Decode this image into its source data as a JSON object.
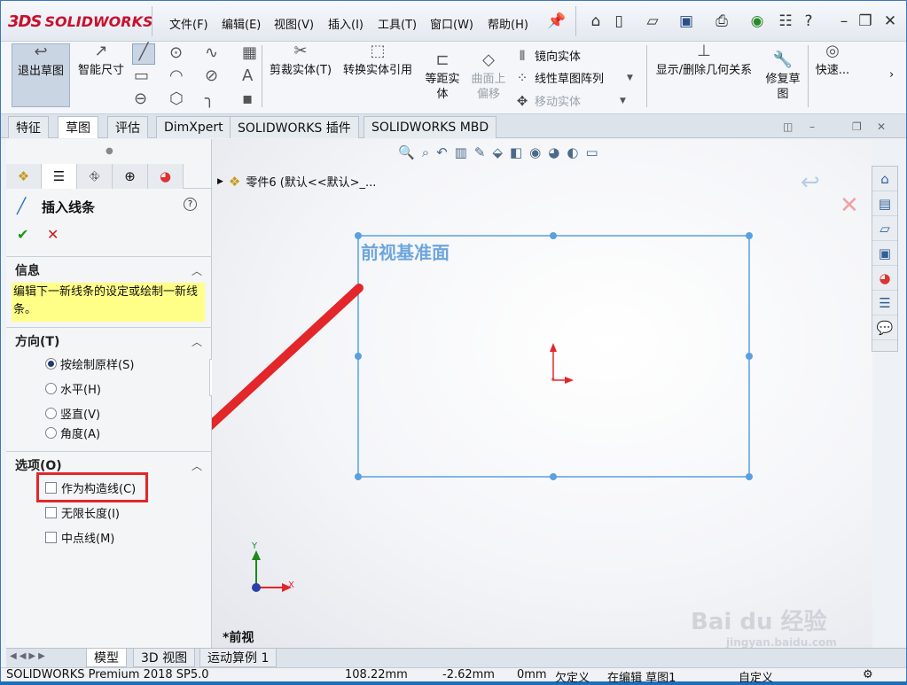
{
  "app": {
    "logo_text": "SOLIDWORKS",
    "logo_mark": "3DS"
  },
  "menu": [
    "文件(F)",
    "编辑(E)",
    "视图(V)",
    "插入(I)",
    "工具(T)",
    "窗口(W)",
    "帮助(H)"
  ],
  "quick_icons": [
    "pin-icon",
    "home-icon",
    "new-file-icon",
    "open-file-icon",
    "save-icon",
    "print-icon",
    "traffic-light-icon",
    "options-icon",
    "help-icon",
    "minimize-icon",
    "restore-icon",
    "close-icon"
  ],
  "commands": {
    "exit_sketch": "退出草图",
    "smart_dimension": "智能尺寸",
    "trim": "剪裁实体(T)",
    "convert": "转换实体引用",
    "offset_line1": "等距实",
    "offset_line2": "体",
    "surface_offset_line1": "曲面上",
    "surface_offset_line2": "偏移",
    "mirror": "镜向实体",
    "linear_pattern": "线性草图阵列",
    "move": "移动实体",
    "display_relations": "显示/删除几何关系",
    "repair_line1": "修复草",
    "repair_line2": "图",
    "quick": "快速..."
  },
  "tabs": [
    "特征",
    "草图",
    "评估",
    "DimXpert",
    "SOLIDWORKS 插件",
    "SOLIDWORKS MBD"
  ],
  "active_tab": "草图",
  "panel": {
    "title": "插入线条",
    "info_header": "信息",
    "info_text": "编辑下一新线条的设定或绘制一新线条。",
    "direction_header": "方向(T)",
    "directions": [
      "按绘制原样(S)",
      "水平(H)",
      "竖直(V)",
      "角度(A)"
    ],
    "direction_selected": "按绘制原样(S)",
    "options_header": "选项(O)",
    "options": [
      "作为构造线(C)",
      "无限长度(I)",
      "中点线(M)"
    ]
  },
  "tree": {
    "item": "零件6 (默认<<默认>_..."
  },
  "plane_label": "前视基准面",
  "view_label": "*前视",
  "axis": {
    "x": "X",
    "y": "Y"
  },
  "bottom_tabs": [
    "模型",
    "3D 视图",
    "运动算例 1"
  ],
  "bottom_active": "模型",
  "status": {
    "product": "SOLIDWORKS Premium 2018 SP5.0",
    "x": "108.22mm",
    "y": "-2.62mm",
    "z": "0mm",
    "defined": "欠定义",
    "editing": "在编辑 草图1",
    "custom": "自定义"
  },
  "watermark": {
    "brand": "Bai du 经验",
    "url": "jingyan.baidu.com"
  },
  "colors": {
    "accent": "#1e6fb8",
    "sketch_line": "#5aa0e0",
    "plane_text": "#6ea6dd",
    "arrow": "#e3262a",
    "info_bg": "#ffff88",
    "highlight": "#e3262a"
  }
}
